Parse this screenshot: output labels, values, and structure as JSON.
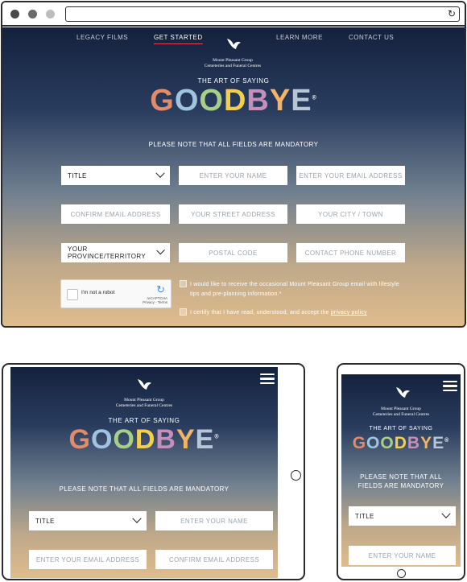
{
  "brand": {
    "name_line1": "Mount Pleasant Group",
    "name_line2": "Cemeteries and Funeral Centres",
    "tagline": "THE ART OF SAYING",
    "headline_letters": [
      "G",
      "O",
      "O",
      "D",
      "B",
      "Y",
      "E"
    ],
    "headline_colors": [
      "#e28b6b",
      "#9fc3e0",
      "#a7cf8a",
      "#f2cf4f",
      "#c48fb9",
      "#f3b565",
      "#b6c6d6"
    ],
    "trademark": "®"
  },
  "nav": {
    "items": [
      "LEGACY FILMS",
      "GET STARTED",
      "LEARN MORE",
      "CONTACT US"
    ],
    "active_index": 1,
    "active_color": "#e04848"
  },
  "form": {
    "notice": "PLEASE NOTE THAT ALL FIELDS ARE MANDATORY",
    "title_select": "TITLE",
    "name": "ENTER YOUR NAME",
    "email": "ENTER YOUR EMAIL ADDRESS",
    "confirm_email": "CONFIRM EMAIL ADDRESS",
    "street": "YOUR STREET ADDRESS",
    "city": "YOUR CITY / TOWN",
    "province_select": "YOUR PROVINCE/TERRITORY",
    "postal": "POSTAL CODE",
    "phone": "CONTACT PHONE NUMBER",
    "recaptcha_label": "I'm not a robot",
    "recaptcha_brand": "reCAPTCHA",
    "recaptcha_links": "Privacy - Terms",
    "consent_email": "I would like to receive the occasional Mount Pleasant Group email with lifestyle tips and pre-planning information.*",
    "certify_text": "I certify that I have read, understood, and accept the",
    "privacy_link": "privacy policy"
  },
  "colors": {
    "frame": "#2b2b2b",
    "dot_red": "#4a4a4a",
    "dot_yellow": "#6a6a6a",
    "dot_green": "#bdbdbd"
  },
  "icons": {
    "reload": "reload-icon",
    "menu": "hamburger-menu-icon",
    "logo": "dove-logo-icon"
  }
}
